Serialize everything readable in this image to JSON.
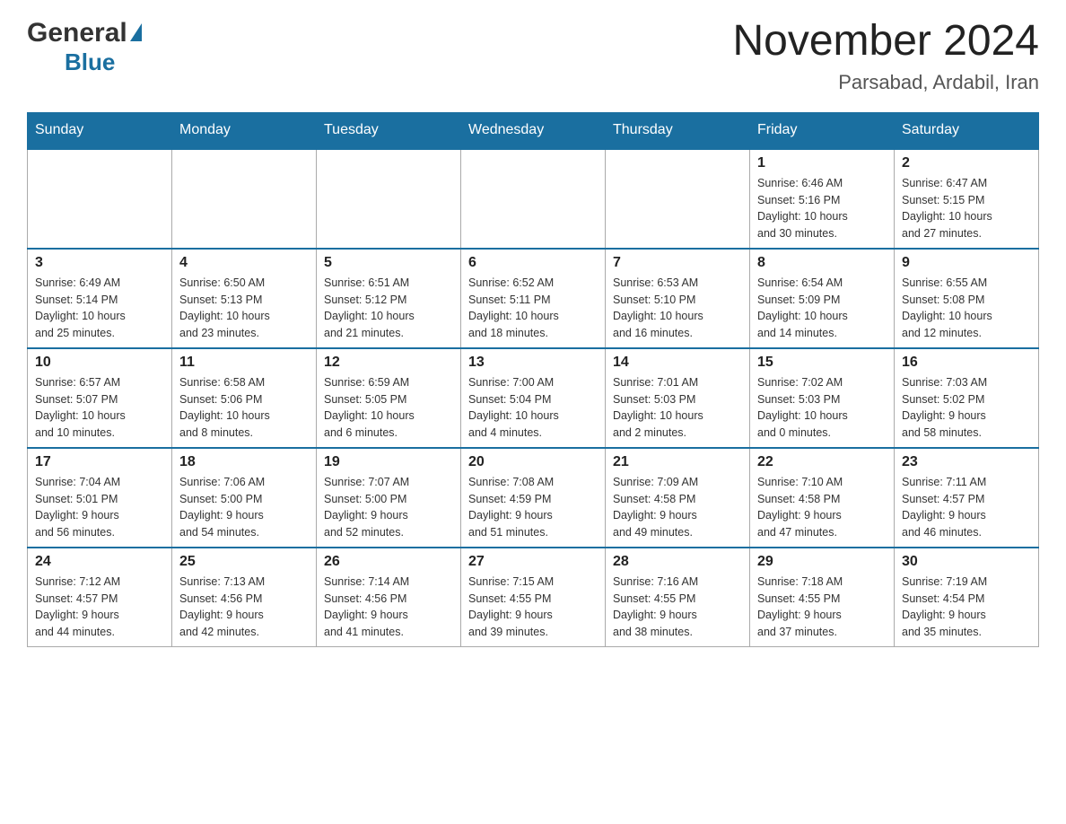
{
  "header": {
    "logo_general": "General",
    "logo_blue": "Blue",
    "month_year": "November 2024",
    "location": "Parsabad, Ardabil, Iran"
  },
  "calendar": {
    "days_of_week": [
      "Sunday",
      "Monday",
      "Tuesday",
      "Wednesday",
      "Thursday",
      "Friday",
      "Saturday"
    ],
    "weeks": [
      [
        {
          "day": "",
          "info": ""
        },
        {
          "day": "",
          "info": ""
        },
        {
          "day": "",
          "info": ""
        },
        {
          "day": "",
          "info": ""
        },
        {
          "day": "",
          "info": ""
        },
        {
          "day": "1",
          "info": "Sunrise: 6:46 AM\nSunset: 5:16 PM\nDaylight: 10 hours\nand 30 minutes."
        },
        {
          "day": "2",
          "info": "Sunrise: 6:47 AM\nSunset: 5:15 PM\nDaylight: 10 hours\nand 27 minutes."
        }
      ],
      [
        {
          "day": "3",
          "info": "Sunrise: 6:49 AM\nSunset: 5:14 PM\nDaylight: 10 hours\nand 25 minutes."
        },
        {
          "day": "4",
          "info": "Sunrise: 6:50 AM\nSunset: 5:13 PM\nDaylight: 10 hours\nand 23 minutes."
        },
        {
          "day": "5",
          "info": "Sunrise: 6:51 AM\nSunset: 5:12 PM\nDaylight: 10 hours\nand 21 minutes."
        },
        {
          "day": "6",
          "info": "Sunrise: 6:52 AM\nSunset: 5:11 PM\nDaylight: 10 hours\nand 18 minutes."
        },
        {
          "day": "7",
          "info": "Sunrise: 6:53 AM\nSunset: 5:10 PM\nDaylight: 10 hours\nand 16 minutes."
        },
        {
          "day": "8",
          "info": "Sunrise: 6:54 AM\nSunset: 5:09 PM\nDaylight: 10 hours\nand 14 minutes."
        },
        {
          "day": "9",
          "info": "Sunrise: 6:55 AM\nSunset: 5:08 PM\nDaylight: 10 hours\nand 12 minutes."
        }
      ],
      [
        {
          "day": "10",
          "info": "Sunrise: 6:57 AM\nSunset: 5:07 PM\nDaylight: 10 hours\nand 10 minutes."
        },
        {
          "day": "11",
          "info": "Sunrise: 6:58 AM\nSunset: 5:06 PM\nDaylight: 10 hours\nand 8 minutes."
        },
        {
          "day": "12",
          "info": "Sunrise: 6:59 AM\nSunset: 5:05 PM\nDaylight: 10 hours\nand 6 minutes."
        },
        {
          "day": "13",
          "info": "Sunrise: 7:00 AM\nSunset: 5:04 PM\nDaylight: 10 hours\nand 4 minutes."
        },
        {
          "day": "14",
          "info": "Sunrise: 7:01 AM\nSunset: 5:03 PM\nDaylight: 10 hours\nand 2 minutes."
        },
        {
          "day": "15",
          "info": "Sunrise: 7:02 AM\nSunset: 5:03 PM\nDaylight: 10 hours\nand 0 minutes."
        },
        {
          "day": "16",
          "info": "Sunrise: 7:03 AM\nSunset: 5:02 PM\nDaylight: 9 hours\nand 58 minutes."
        }
      ],
      [
        {
          "day": "17",
          "info": "Sunrise: 7:04 AM\nSunset: 5:01 PM\nDaylight: 9 hours\nand 56 minutes."
        },
        {
          "day": "18",
          "info": "Sunrise: 7:06 AM\nSunset: 5:00 PM\nDaylight: 9 hours\nand 54 minutes."
        },
        {
          "day": "19",
          "info": "Sunrise: 7:07 AM\nSunset: 5:00 PM\nDaylight: 9 hours\nand 52 minutes."
        },
        {
          "day": "20",
          "info": "Sunrise: 7:08 AM\nSunset: 4:59 PM\nDaylight: 9 hours\nand 51 minutes."
        },
        {
          "day": "21",
          "info": "Sunrise: 7:09 AM\nSunset: 4:58 PM\nDaylight: 9 hours\nand 49 minutes."
        },
        {
          "day": "22",
          "info": "Sunrise: 7:10 AM\nSunset: 4:58 PM\nDaylight: 9 hours\nand 47 minutes."
        },
        {
          "day": "23",
          "info": "Sunrise: 7:11 AM\nSunset: 4:57 PM\nDaylight: 9 hours\nand 46 minutes."
        }
      ],
      [
        {
          "day": "24",
          "info": "Sunrise: 7:12 AM\nSunset: 4:57 PM\nDaylight: 9 hours\nand 44 minutes."
        },
        {
          "day": "25",
          "info": "Sunrise: 7:13 AM\nSunset: 4:56 PM\nDaylight: 9 hours\nand 42 minutes."
        },
        {
          "day": "26",
          "info": "Sunrise: 7:14 AM\nSunset: 4:56 PM\nDaylight: 9 hours\nand 41 minutes."
        },
        {
          "day": "27",
          "info": "Sunrise: 7:15 AM\nSunset: 4:55 PM\nDaylight: 9 hours\nand 39 minutes."
        },
        {
          "day": "28",
          "info": "Sunrise: 7:16 AM\nSunset: 4:55 PM\nDaylight: 9 hours\nand 38 minutes."
        },
        {
          "day": "29",
          "info": "Sunrise: 7:18 AM\nSunset: 4:55 PM\nDaylight: 9 hours\nand 37 minutes."
        },
        {
          "day": "30",
          "info": "Sunrise: 7:19 AM\nSunset: 4:54 PM\nDaylight: 9 hours\nand 35 minutes."
        }
      ]
    ]
  }
}
